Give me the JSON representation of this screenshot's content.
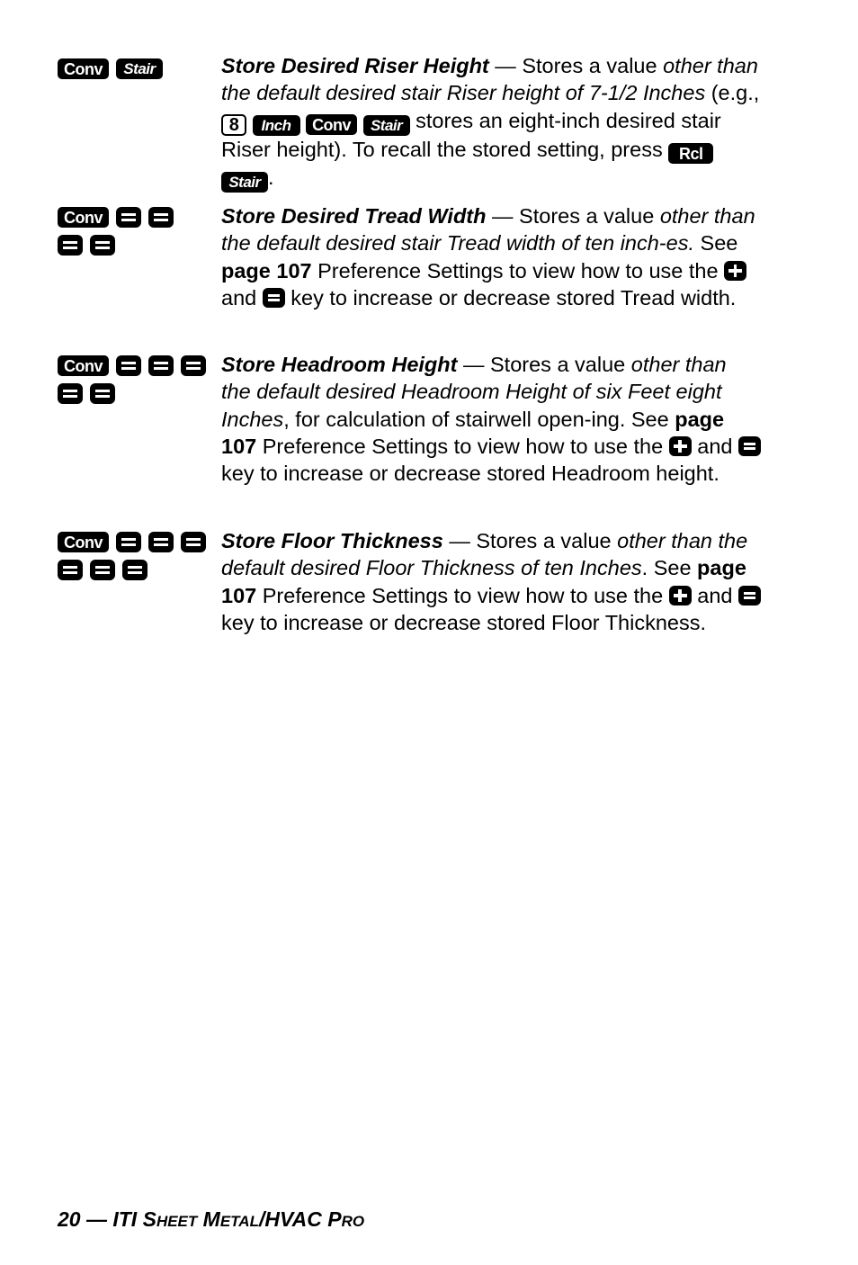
{
  "keys": {
    "conv": "Conv",
    "stair": "Stair",
    "inch": "Inch",
    "rcl": "Rcl",
    "eight": "8"
  },
  "entries": [
    {
      "title": "Store Desired Riser Height",
      "dash": " — Stores a value ",
      "i1": "other than the default desired stair Riser height of 7-1/2 Inches",
      "t2": " (e.g., ",
      "t3": " stores an eight-inch desired stair Riser height). To recall the stored setting, press ",
      "t4": "."
    },
    {
      "title": "Store Desired Tread Width",
      "dash": " — Stores a value ",
      "i1": "other than the default desired stair Tread width of ten inch-es.",
      "t2": " See ",
      "page": "page 107",
      "t3": " Preference Settings to view how to use the ",
      "and": " and ",
      "t4": " key to increase or decrease stored Tread width."
    },
    {
      "title": "Store Headroom Height",
      "dash": " — Stores a value ",
      "i1": "other than the default desired Headroom Height of six Feet eight Inches",
      "t2": ", for calculation of stairwell open-ing. See ",
      "page": "page 107",
      "t3": " Preference Settings to view how to use the ",
      "and": " and ",
      "t4": " key to increase or decrease stored Headroom height."
    },
    {
      "title": "Store Floor Thickness",
      "dash": " — Stores a value ",
      "i1": "other than the default desired Floor Thickness of ten Inches",
      "t2": ". See ",
      "page": "page 107",
      "t3": " Preference Settings to view how to use the ",
      "and": " and ",
      "t4": " key to increase or decrease stored Floor Thickness."
    }
  ],
  "footer": {
    "num": "20 — ITI S",
    "s1": "HEET",
    "m": " M",
    "s2": "ETAL",
    "hv": "/HVAC P",
    "s3": "RO"
  }
}
